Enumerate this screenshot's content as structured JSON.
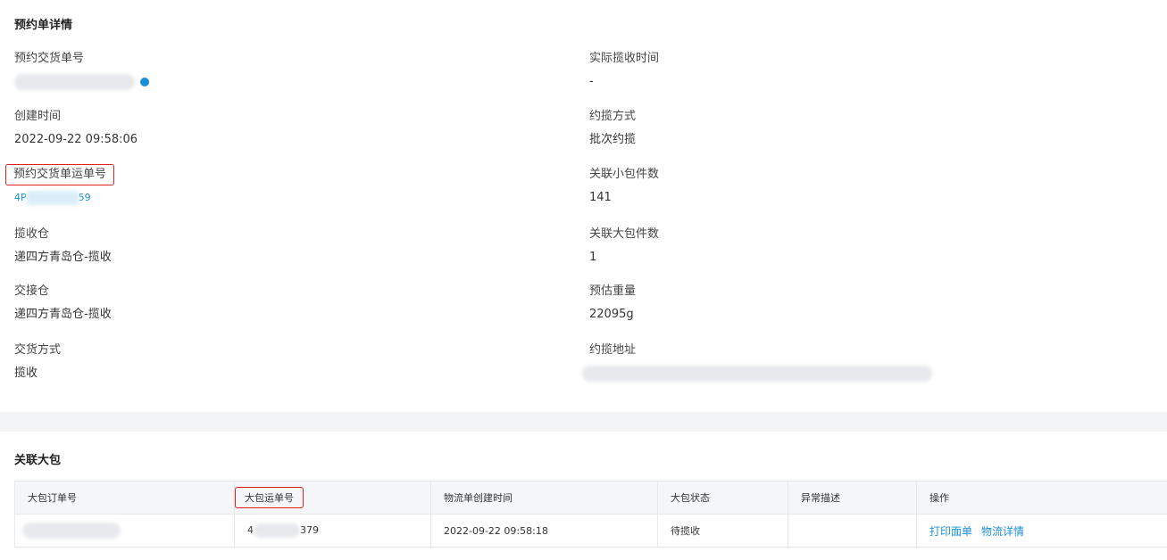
{
  "detail": {
    "title": "预约单详情",
    "left": [
      {
        "label": "预约交货单号",
        "value": ""
      },
      {
        "label": "创建时间",
        "value": "2022-09-22 09:58:06"
      },
      {
        "label": "预约交货单运单号",
        "value_prefix": "4P",
        "value_suffix": "59"
      },
      {
        "label": "揽收仓",
        "value": "递四方青岛仓-揽收"
      },
      {
        "label": "交接仓",
        "value": "递四方青岛仓-揽收"
      },
      {
        "label": "交货方式",
        "value": "揽收"
      }
    ],
    "right": [
      {
        "label": "实际揽收时间",
        "value": "-"
      },
      {
        "label": "约揽方式",
        "value": "批次约揽"
      },
      {
        "label": "关联小包件数",
        "value": "141"
      },
      {
        "label": "关联大包件数",
        "value": "1"
      },
      {
        "label": "预估重量",
        "value": "22095g"
      },
      {
        "label": "约揽地址",
        "value": ""
      }
    ]
  },
  "packages": {
    "title": "关联大包",
    "columns": [
      "大包订单号",
      "大包运单号",
      "物流单创建时间",
      "大包状态",
      "异常描述",
      "操作"
    ],
    "rows": [
      {
        "order_no": "",
        "waybill_prefix": "4",
        "waybill_suffix": "379",
        "created": "2022-09-22 09:58:18",
        "status": "待揽收",
        "exception": "",
        "actions": [
          "打印面单",
          "物流详情"
        ]
      }
    ]
  },
  "colors": {
    "link": "#1a8fd8",
    "highlight": "#e02020"
  }
}
